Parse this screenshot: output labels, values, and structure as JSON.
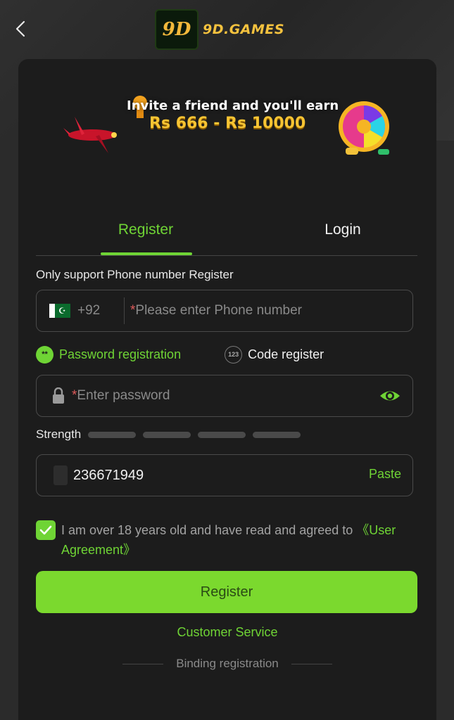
{
  "header": {
    "logo_badge": "9D",
    "logo_text": "9D.GAMES"
  },
  "banner": {
    "line1": "Invite a friend and you'll earn",
    "line2": "Rs 666 - Rs 10000"
  },
  "tabs": [
    {
      "label": "Register",
      "active": true
    },
    {
      "label": "Login",
      "active": false
    }
  ],
  "form": {
    "info_text": "Only support Phone number Register",
    "phone": {
      "country_code": "+92",
      "required_mark": "*",
      "placeholder": "Please enter Phone number"
    },
    "options": [
      {
        "label": "Password registration",
        "icon_text": "**",
        "active": true
      },
      {
        "label": "Code register",
        "icon_text": "123",
        "active": false
      }
    ],
    "password": {
      "required_mark": "*",
      "placeholder": "Enter password"
    },
    "strength_label": "Strength",
    "invite": {
      "value": "236671949",
      "paste_label": "Paste"
    },
    "agreement": {
      "text": "I am over 18 years old and have read and agreed to ",
      "link": "《User Agreement》",
      "checked": true
    },
    "submit_label": "Register"
  },
  "footer": {
    "customer_service": "Customer Service",
    "binding": "Binding registration"
  },
  "colors": {
    "accent": "#6fd435",
    "button": "#7bd92e",
    "card_bg": "#1c1c1c",
    "page_bg": "#2b2b2b",
    "brand_gold": "#f5c23e"
  }
}
